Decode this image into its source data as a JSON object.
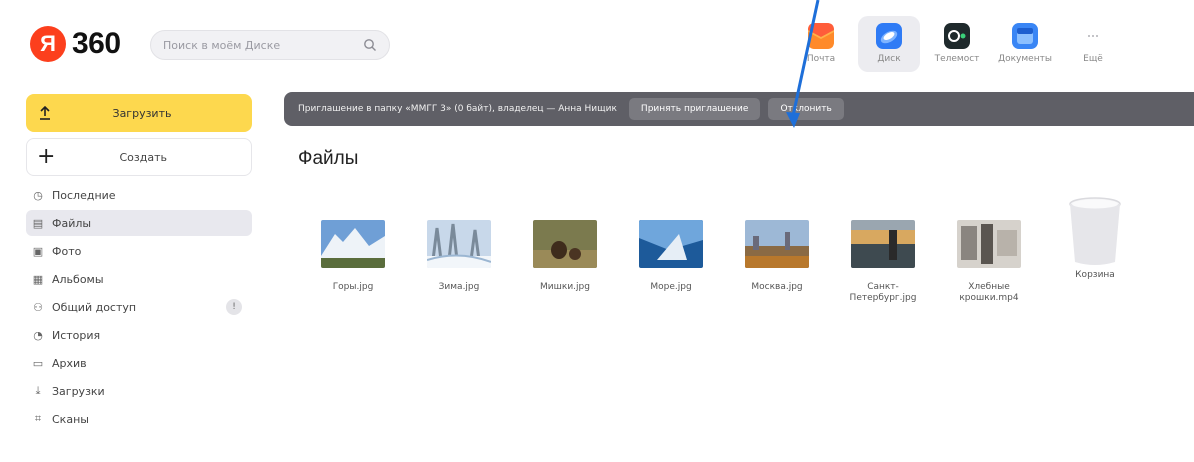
{
  "header": {
    "logo_letter": "Я",
    "logo_text": "360",
    "search_placeholder": "Поиск в моём Диске",
    "services": [
      {
        "label": "Почта",
        "icon": "mail-icon",
        "color": "#fb8a2a"
      },
      {
        "label": "Диск",
        "icon": "disk-icon",
        "color": "#2f7bf5"
      },
      {
        "label": "Телемост",
        "icon": "telemost-icon",
        "color": "#1f2a2c"
      },
      {
        "label": "Документы",
        "icon": "documents-icon",
        "color": "#3a86f5"
      },
      {
        "label": "Ещё",
        "icon": "more-icon",
        "color": "#cccccc"
      }
    ]
  },
  "sidebar": {
    "upload_label": "Загрузить",
    "create_label": "Создать",
    "items": [
      {
        "label": "Последние",
        "icon": "clock-icon",
        "glyph": "◷"
      },
      {
        "label": "Файлы",
        "icon": "file-icon",
        "glyph": "▤"
      },
      {
        "label": "Фото",
        "icon": "photo-icon",
        "glyph": "▣"
      },
      {
        "label": "Альбомы",
        "icon": "albums-icon",
        "glyph": "▦"
      },
      {
        "label": "Общий доступ",
        "icon": "shared-icon",
        "glyph": "⚇",
        "badge": "!"
      },
      {
        "label": "История",
        "icon": "history-icon",
        "glyph": "◔"
      },
      {
        "label": "Архив",
        "icon": "archive-icon",
        "glyph": "▭"
      },
      {
        "label": "Загрузки",
        "icon": "downloads-icon",
        "glyph": "⤓"
      },
      {
        "label": "Сканы",
        "icon": "scans-icon",
        "glyph": "⌗"
      }
    ]
  },
  "notification": {
    "text": "Приглашение в папку «ММГГ 3» (0 байт), владелец — Анна Нищик",
    "accept_label": "Принять приглашение",
    "decline_label": "Отклонить"
  },
  "main": {
    "title": "Файлы",
    "files": [
      {
        "name": "Горы.jpg",
        "icon": "image-thumb"
      },
      {
        "name": "Зима.jpg",
        "icon": "image-thumb"
      },
      {
        "name": "Мишки.jpg",
        "icon": "image-thumb"
      },
      {
        "name": "Море.jpg",
        "icon": "image-thumb"
      },
      {
        "name": "Москва.jpg",
        "icon": "image-thumb"
      },
      {
        "name": "Санкт-Петербург.jpg",
        "icon": "image-thumb"
      },
      {
        "name": "Хлебные крошки.mp4",
        "icon": "video-thumb"
      },
      {
        "name": "Корзина",
        "icon": "trash-icon"
      }
    ]
  },
  "colors": {
    "accent": "#fdd84e",
    "brand": "#fc3f1d",
    "notification_bg": "#5f5f66",
    "arrow": "#1e6fd9"
  }
}
